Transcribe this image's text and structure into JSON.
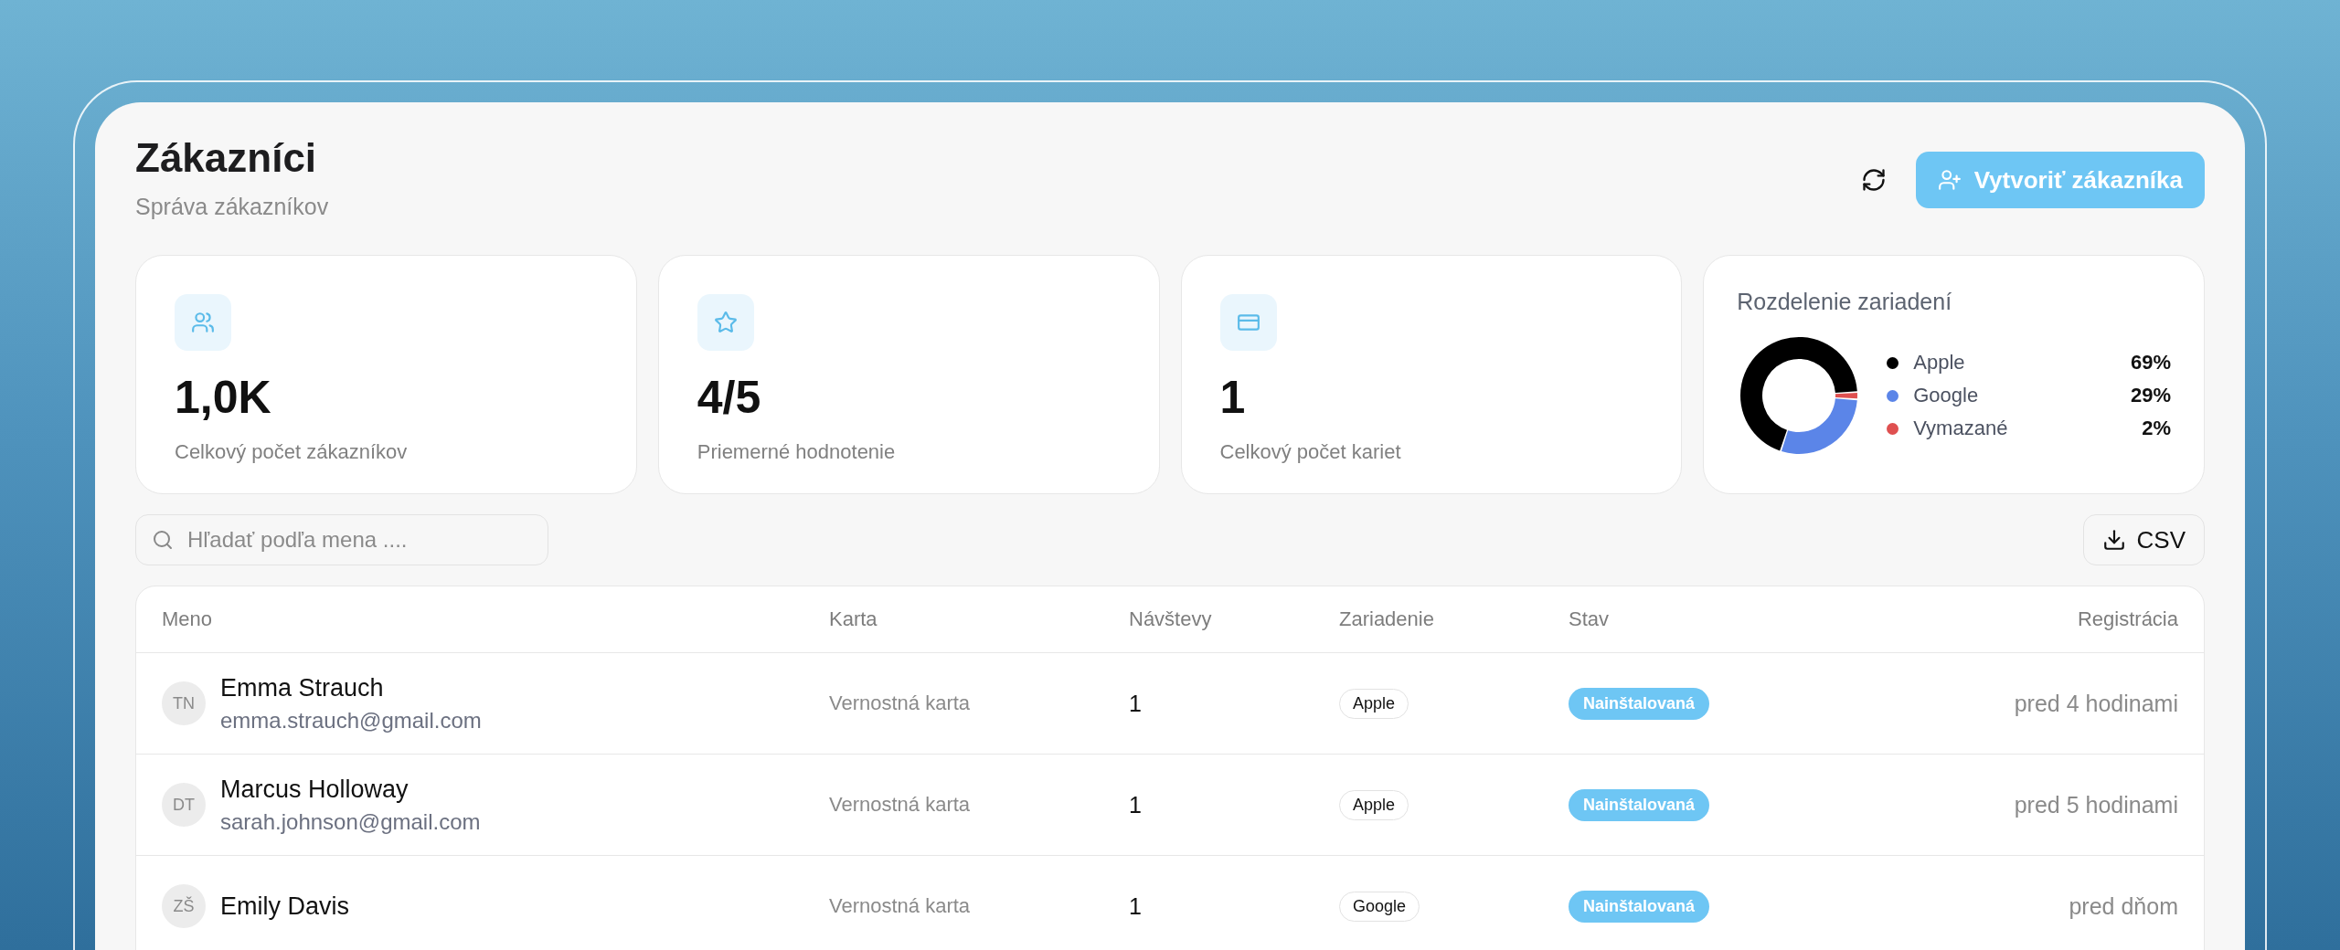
{
  "header": {
    "title": "Zákazníci",
    "subtitle": "Správa zákazníkov",
    "create_button": "Vytvoriť zákazníka"
  },
  "stats": [
    {
      "kind": "users",
      "value": "1,0K",
      "label": "Celkový počet zákazníkov"
    },
    {
      "kind": "star",
      "value": "4/5",
      "label": "Priemerné hodnotenie"
    },
    {
      "kind": "card",
      "value": "1",
      "label": "Celkový počet kariet"
    }
  ],
  "device_split": {
    "chart_data": {
      "type": "donut",
      "title": "Rozdelenie zariadení",
      "categories": [
        "Apple",
        "Google",
        "Vymazané"
      ],
      "values": [
        69,
        29,
        2
      ]
    },
    "legend": [
      {
        "percent": "69%",
        "color": "#000000"
      },
      {
        "percent": "29%",
        "color": "#5b85e8"
      },
      {
        "percent": "2%",
        "color": "#df5050"
      }
    ]
  },
  "search": {
    "placeholder": "Hľadať podľa mena ...."
  },
  "export_button": "CSV",
  "table": {
    "columns": [
      "Meno",
      "Karta",
      "Návštevy",
      "Zariadenie",
      "Stav",
      "Registrácia"
    ],
    "rows": [
      {
        "initials": "TN",
        "name": "Emma Strauch",
        "email": "emma.strauch@gmail.com",
        "card": "Vernostná karta",
        "visits": "1",
        "device": "Apple",
        "status": "Nainštalovaná",
        "registered": "pred 4 hodinami"
      },
      {
        "initials": "DT",
        "name": "Marcus Holloway",
        "email": "sarah.johnson@gmail.com",
        "card": "Vernostná karta",
        "visits": "1",
        "device": "Apple",
        "status": "Nainštalovaná",
        "registered": "pred 5 hodinami"
      },
      {
        "initials": "ZŠ",
        "name": "Emily Davis",
        "card": "Vernostná karta",
        "visits": "1",
        "device": "Google",
        "status": "Nainštalovaná",
        "registered": "pred dňom"
      }
    ]
  }
}
